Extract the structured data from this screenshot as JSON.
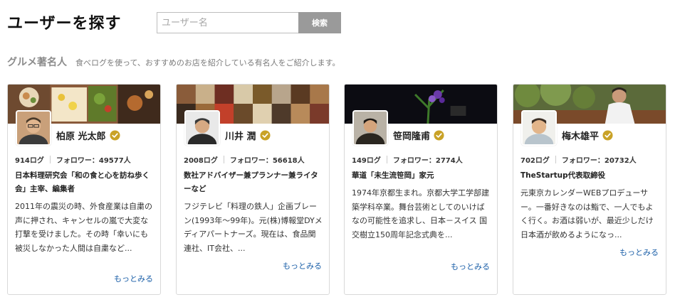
{
  "header": {
    "title": "ユーザーを探す",
    "search_placeholder": "ユーザー名",
    "search_button": "検索"
  },
  "section": {
    "title": "グルメ著名人",
    "description": "食べログを使って、おすすめのお店を紹介している有名人をご紹介します。"
  },
  "separator": "|",
  "colors": {
    "link": "#1b5fa8",
    "badge": "#c9a227",
    "search_button": "#9a9a9a"
  },
  "cards": [
    {
      "name": "柏原 光太郎",
      "reviews": "914ログ",
      "followers": "フォロワー：49577人",
      "title": "日本料理研究会「和の食と心を訪ね歩く会」主宰、編集者",
      "description": "2011年の震災の時、外食産業は自粛の声に押され、キャンセルの嵐で大変な打撃を受けました。その時「幸いにも被災しなかった人間は自粛など...",
      "more": "もっとみる",
      "cover_icon": "food-bento-photo",
      "avatar_icon": "man-glasses-photo"
    },
    {
      "name": "川井 潤",
      "reviews": "2008ログ",
      "followers": "フォロワー：56618人",
      "title": "数社アドバイザー兼プランナー兼ライターなど",
      "description": "フジテレビ「料理の鉄人」企画ブレーン(1993年〜99年)。元(株)博報堂DYメディアパートナーズ。現在は、食品関連社、IT会社、...",
      "more": "もっとみる",
      "cover_icon": "food-collage-photo",
      "avatar_icon": "man-dark-jacket-photo"
    },
    {
      "name": "笹岡隆甫",
      "reviews": "149ログ",
      "followers": "フォロワー：2774人",
      "title": "華道「未生流笹岡」家元",
      "description": "1974年京都生まれ。京都大学工学部建築学科卒業。舞台芸術としてのいけばなの可能性を追求し、日本－スイス 国交樹立150周年記念式典を...",
      "more": "もっとみる",
      "cover_icon": "ikebana-flower-photo",
      "avatar_icon": "man-kimono-photo"
    },
    {
      "name": "梅木雄平",
      "reviews": "702ログ",
      "followers": "フォロワー：20732人",
      "title": "TheStartup代表取締役",
      "description": "元東京カレンダーWEBプロデューサー。一番好きなのは鮨で、一人でもよく行く。お酒は弱いが、最近少しだけ日本酒が飲めるようになっ...",
      "more": "もっとみる",
      "cover_icon": "man-outdoor-trees-photo",
      "avatar_icon": "man-smiling-photo"
    }
  ]
}
